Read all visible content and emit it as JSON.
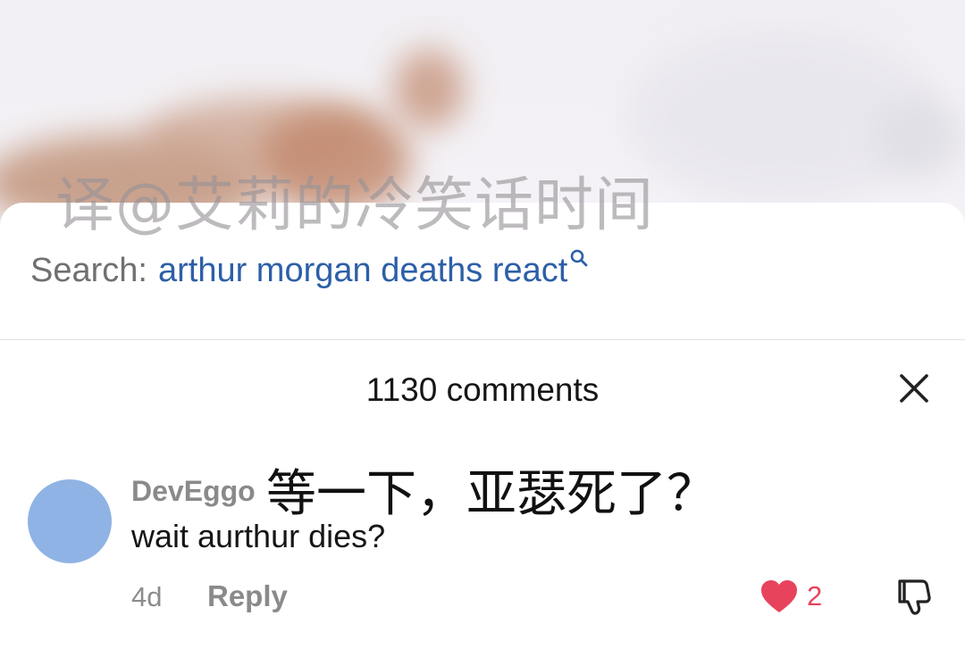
{
  "watermark": "译@艾莉的冷笑话时间",
  "search": {
    "prefix": "Search:",
    "query": "arthur morgan deaths react"
  },
  "comments": {
    "count_label": "1130 comments"
  },
  "comment": {
    "username": "DevEggo",
    "translation": "等一下，亚瑟死了？",
    "text": "wait aurthur dies?",
    "time": "4d",
    "reply_label": "Reply",
    "likes": "2",
    "avatar_color": "#8fb3e4"
  },
  "colors": {
    "search_query": "#2d5fa8",
    "like_heart": "#e8435d"
  },
  "icons": {
    "search": "search-icon",
    "close": "close-icon",
    "like": "heart-icon",
    "dislike": "thumbs-down-icon"
  }
}
